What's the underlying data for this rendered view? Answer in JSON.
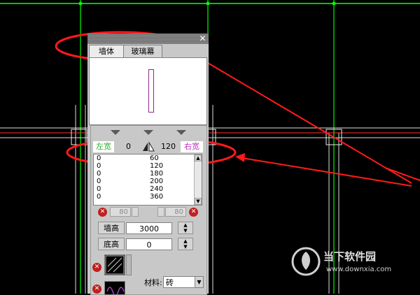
{
  "window": {
    "close_glyph": "✕"
  },
  "tabs": [
    {
      "label": "墙体",
      "active": true
    },
    {
      "label": "玻璃幕",
      "active": false
    }
  ],
  "width_editor": {
    "left_label": "左宽",
    "left_value": "0",
    "right_value": "120",
    "right_label": "右宽",
    "split_icon": "mirror-split-icon",
    "rows": [
      {
        "a": "0",
        "b": "60"
      },
      {
        "a": "0",
        "b": "120"
      },
      {
        "a": "0",
        "b": "180"
      },
      {
        "a": "0",
        "b": "200"
      },
      {
        "a": "0",
        "b": "240"
      },
      {
        "a": "0",
        "b": "360"
      }
    ],
    "left_spin_value": "80",
    "right_spin_value": "80"
  },
  "properties": {
    "wall_height_label": "墙高",
    "wall_height_value": "3000",
    "base_height_label": "底高",
    "base_height_value": "0",
    "material_label": "材料:",
    "material_value": "砖"
  },
  "watermark": {
    "cn": "当下软件园",
    "url": "www.downxia.com"
  },
  "colors": {
    "green_grid": "#00d000",
    "red_axis": "#ff2020",
    "annotation_red": "#ff1a1a",
    "left_label_green": "#2cae2c",
    "right_label_magenta": "#c030c0"
  }
}
